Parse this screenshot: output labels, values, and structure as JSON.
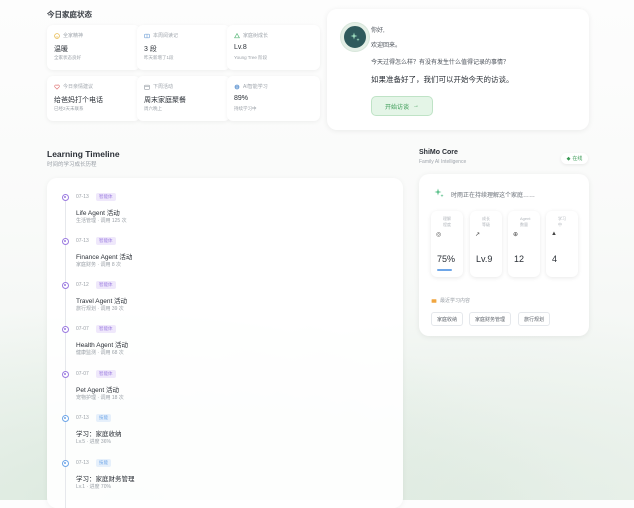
{
  "status": {
    "title": "今日家庭状态",
    "cards": [
      {
        "label": "全家精神",
        "value": "温暖",
        "sub": "全家状态良好",
        "icon": "smile-icon",
        "color": "#e6b84a"
      },
      {
        "label": "本周阅读记",
        "value": "3 段",
        "sub": "昨天新增了1段",
        "icon": "book-icon",
        "color": "#7aa6d8"
      },
      {
        "label": "家庭树成长",
        "value": "Lv.8",
        "sub": "Young Tree 阶段",
        "icon": "tree-icon",
        "color": "#5ab87a"
      },
      {
        "label": "今日亲情建议",
        "value": "给爸妈打个电话",
        "sub": "已经2天未联系",
        "icon": "heart-icon",
        "color": "#e07a7a"
      },
      {
        "label": "下周活动",
        "value": "周末家庭聚餐",
        "sub": "周六晚上",
        "icon": "calendar-icon",
        "color": "#9aa0a7"
      },
      {
        "label": "AI智能学习",
        "value": "89%",
        "sub": "持续学习中",
        "icon": "info-icon",
        "color": "#7aa6d8"
      }
    ]
  },
  "welcome": {
    "greeting": "你好,",
    "back": "欢迎回来。",
    "question": "今天过得怎么样？有没有发生什么值得记录的事情？",
    "prompt": "如果准备好了，我们可以开始今天的访谈。",
    "button": "开始访谈",
    "avatar_icon": "sparkle-icon"
  },
  "timeline": {
    "title": "Learning Timeline",
    "subtitle": "时间的学习成长历程",
    "items": [
      {
        "date": "07-13",
        "badge": "智能体",
        "name": "Life Agent 活动",
        "meta": "生活管理 · 调用 125 次",
        "kind": "agent"
      },
      {
        "date": "07-13",
        "badge": "智能体",
        "name": "Finance Agent 活动",
        "meta": "家庭财务 · 调用 8 次",
        "kind": "agent"
      },
      {
        "date": "07-12",
        "badge": "智能体",
        "name": "Travel Agent 活动",
        "meta": "旅行规划 · 调用 39 次",
        "kind": "agent"
      },
      {
        "date": "07-07",
        "badge": "智能体",
        "name": "Health Agent 活动",
        "meta": "健康监测 · 调用 68 次",
        "kind": "agent"
      },
      {
        "date": "07-07",
        "badge": "智能体",
        "name": "Pet Agent 活动",
        "meta": "宠物护理 · 调用 18 次",
        "kind": "agent"
      },
      {
        "date": "07-13",
        "badge": "技能",
        "name": "学习：家庭收纳",
        "meta": "Lv.5 · 进度 36%",
        "kind": "skill"
      },
      {
        "date": "07-13",
        "badge": "技能",
        "name": "学习：家庭财务管理",
        "meta": "Lv.1 · 进度 70%",
        "kind": "skill"
      }
    ],
    "colors": {
      "agent": "#9b7be0",
      "skill": "#6ea6e8"
    }
  },
  "core": {
    "title": "ShiMo Core",
    "subtitle": "Family AI Intelligence",
    "status": "在线",
    "thinking": "时雨正在持续理解这个家庭……",
    "metrics": [
      {
        "label": "理解程度",
        "value": "75%",
        "icon": "target-icon",
        "progress": 0.75
      },
      {
        "label": "成长等级",
        "value": "Lv.9",
        "icon": "trend-icon"
      },
      {
        "label": "Agent数量",
        "value": "12",
        "icon": "globe-icon"
      },
      {
        "label": "学习中",
        "value": "4",
        "icon": "cap-icon"
      }
    ],
    "recent_label": "最近学习内容",
    "tags": [
      "家庭收纳",
      "家庭财务管理",
      "旅行规划"
    ]
  }
}
